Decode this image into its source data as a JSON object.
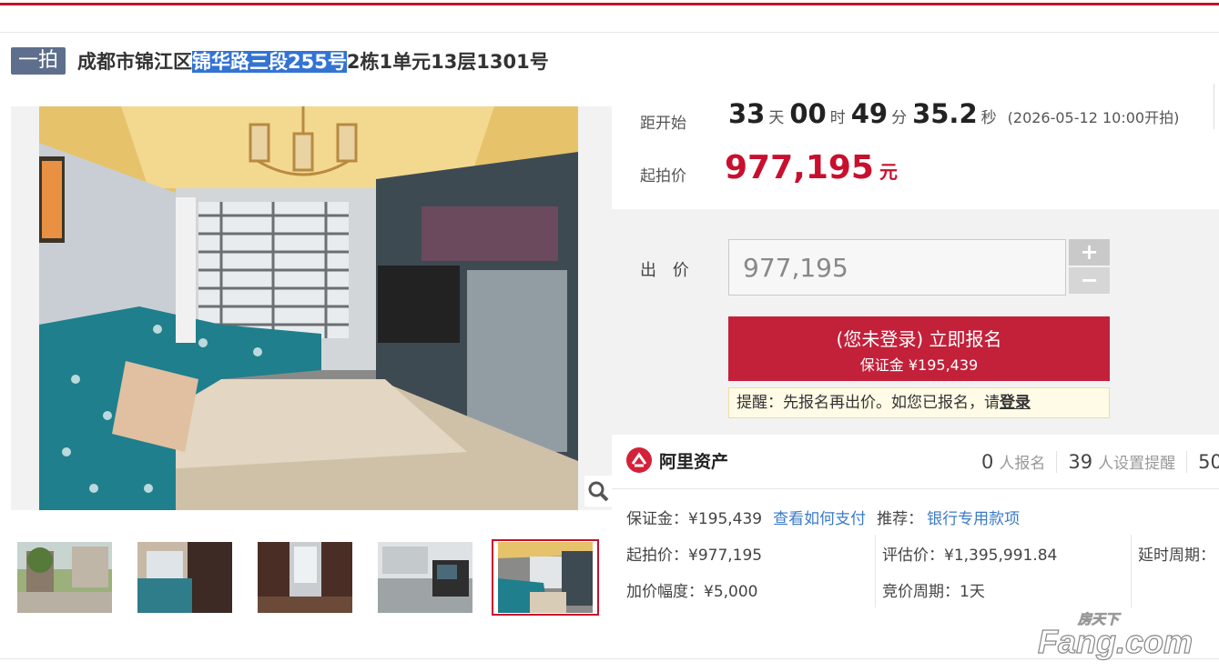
{
  "auction": {
    "tag": "一拍",
    "title_prefix": "成都市锦江区",
    "title_highlight": "锦华路三段255号",
    "title_suffix": "2栋1单元13层1301号"
  },
  "countdown": {
    "label": "距开始",
    "days": "33",
    "days_unit": "天",
    "hours": "00",
    "hours_unit": "时",
    "minutes": "49",
    "minutes_unit": "分",
    "seconds": "35.2",
    "seconds_unit": "秒",
    "start_time": "(2026-05-12 10:00开拍)"
  },
  "starting_price": {
    "label": "起拍价",
    "value": "977,195",
    "unit": "元"
  },
  "bid": {
    "label": "出 价",
    "input_value": "977,195",
    "plus": "+",
    "minus": "−",
    "signup_line1": "(您未登录) 立即报名",
    "signup_line2": "保证金 ¥195,439",
    "reminder_text": "提醒：先报名再出价。如您已报名，请",
    "reminder_link": "登录"
  },
  "ali": {
    "brand": "阿里资产",
    "signups_count": "0",
    "signups_label": "人报名",
    "reminders_count": "39",
    "reminders_label": "人设置提醒",
    "views_count": "50"
  },
  "details": {
    "deposit": "保证金：¥195,439",
    "how_to_pay": "查看如何支付",
    "recommend_label": "推荐：",
    "recommend_link": "银行专用款项",
    "start_price": "起拍价：¥977,195",
    "appraisal": "评估价：¥1,395,991.84",
    "extension": "延时周期：",
    "increment": "加价幅度：¥5,000",
    "bidding_period": "竞价周期：1天"
  },
  "watermark": {
    "line1": "房天下",
    "line2": "Fang.com"
  },
  "colors": {
    "accent": "#c8102e",
    "tag_bg": "#5d6f8c",
    "link": "#3b7bc8",
    "highlight": "#3373d4"
  }
}
